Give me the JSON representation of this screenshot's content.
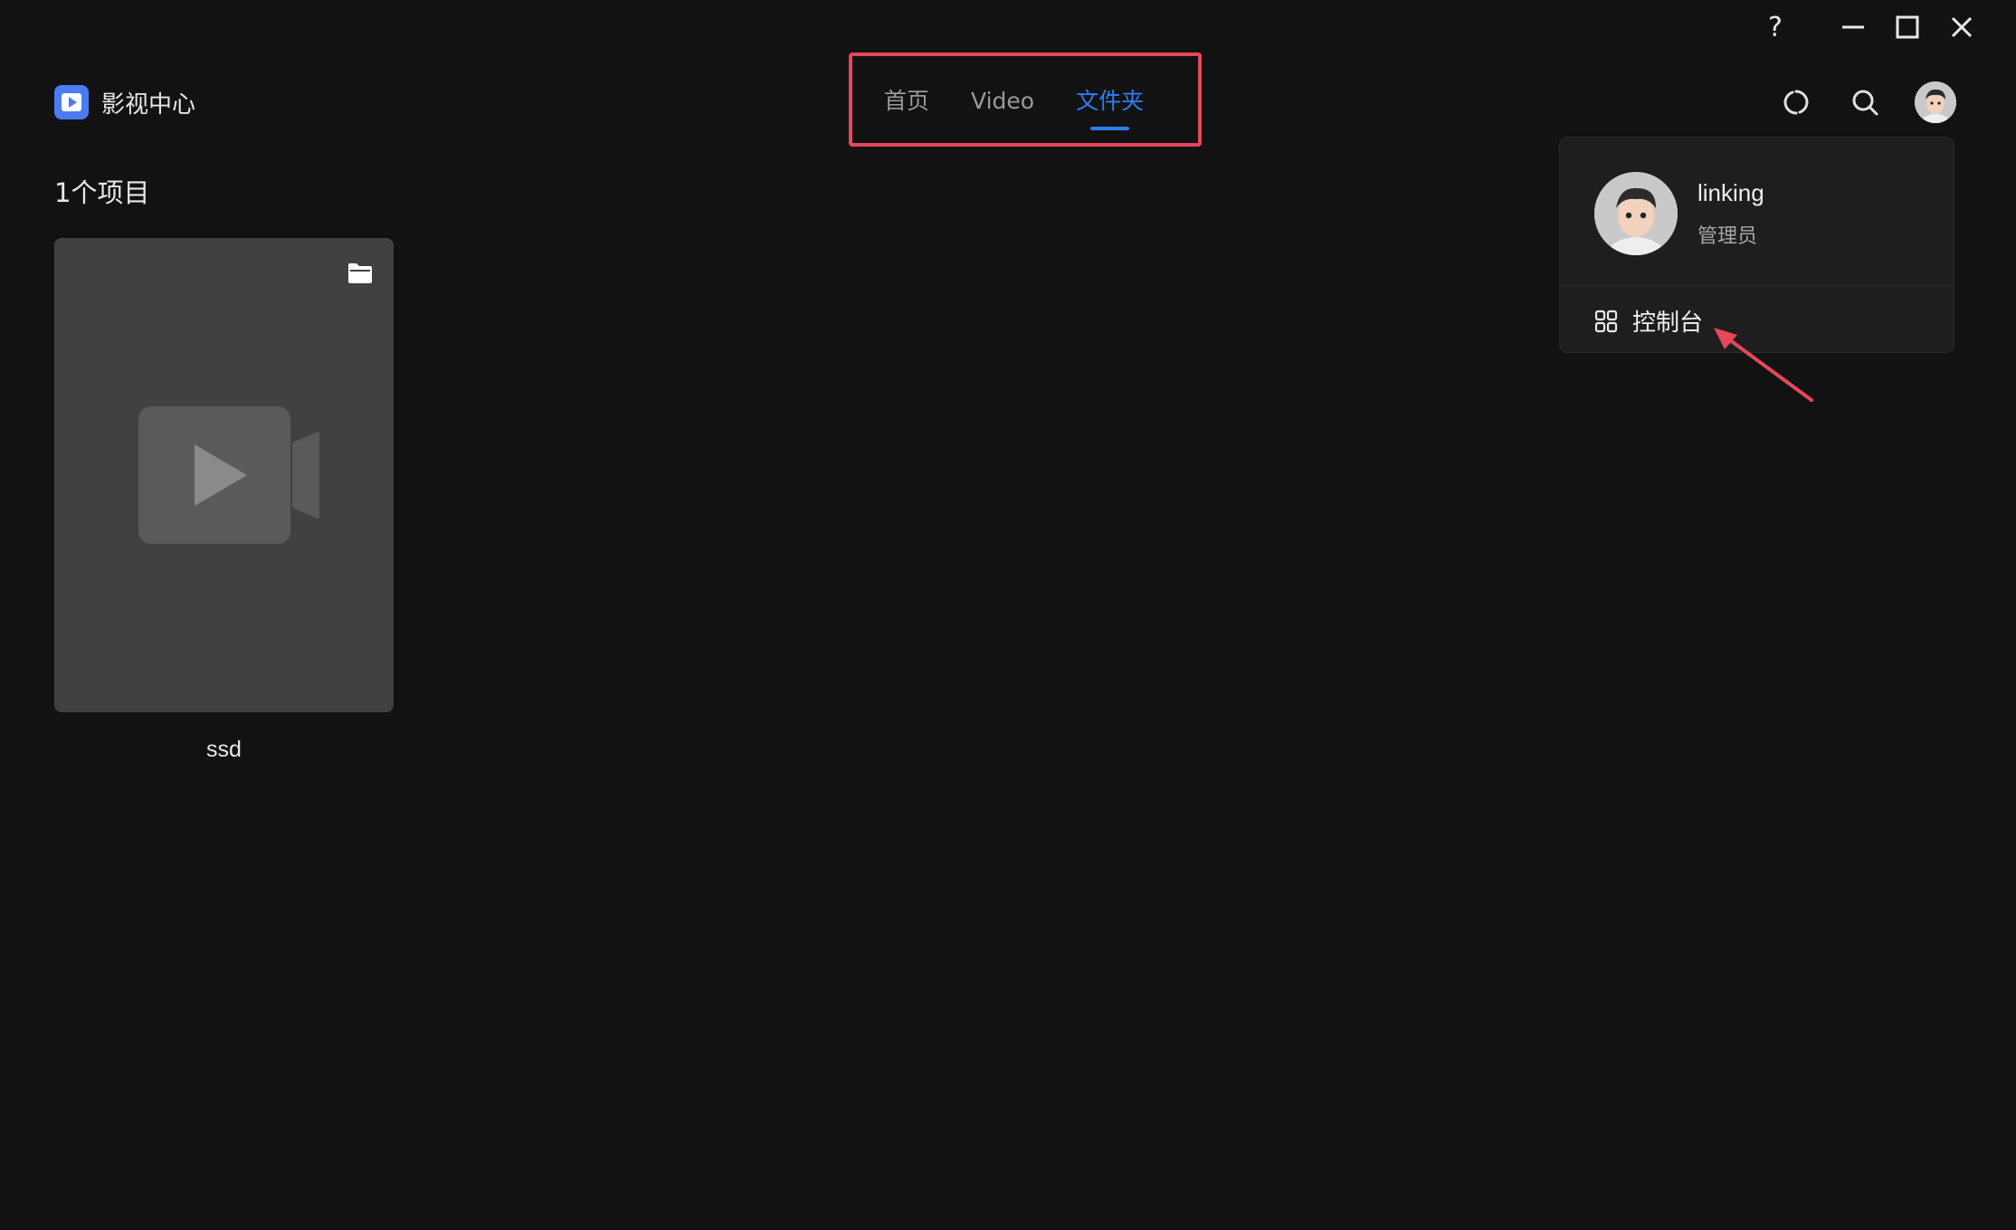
{
  "window": {
    "help_label": "?",
    "minimize_icon": "minimize-icon",
    "maximize_icon": "maximize-icon",
    "close_icon": "close-icon"
  },
  "app": {
    "title": "影视中心",
    "logo_icon": "play-square-icon",
    "accent_color": "#2d7cf6",
    "logo_color": "#4c7cf5"
  },
  "tabs": [
    {
      "label": "首页",
      "active": false
    },
    {
      "label": "Video",
      "active": false
    },
    {
      "label": "文件夹",
      "active": true
    }
  ],
  "header_icons": [
    "refresh-icon",
    "search-icon",
    "avatar"
  ],
  "content": {
    "item_count_label": "1个项目",
    "items": [
      {
        "name": "ssd",
        "type": "folder",
        "badge_icon": "folder-icon",
        "placeholder_icon": "video-camera-icon"
      }
    ]
  },
  "user_menu": {
    "username": "linking",
    "role": "管理员",
    "console_label": "控制台",
    "console_icon": "grid-icon"
  },
  "annotation": {
    "highlight_color": "#e6475c"
  }
}
